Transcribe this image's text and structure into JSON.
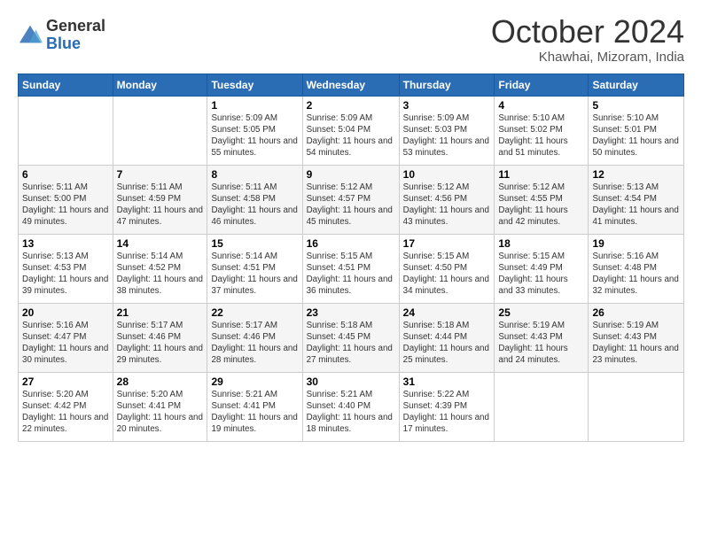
{
  "header": {
    "logo_general": "General",
    "logo_blue": "Blue",
    "month_title": "October 2024",
    "location": "Khawhai, Mizoram, India"
  },
  "weekdays": [
    "Sunday",
    "Monday",
    "Tuesday",
    "Wednesday",
    "Thursday",
    "Friday",
    "Saturday"
  ],
  "weeks": [
    [
      {
        "day": "",
        "sunrise": "",
        "sunset": "",
        "daylight": ""
      },
      {
        "day": "",
        "sunrise": "",
        "sunset": "",
        "daylight": ""
      },
      {
        "day": "1",
        "sunrise": "Sunrise: 5:09 AM",
        "sunset": "Sunset: 5:05 PM",
        "daylight": "Daylight: 11 hours and 55 minutes."
      },
      {
        "day": "2",
        "sunrise": "Sunrise: 5:09 AM",
        "sunset": "Sunset: 5:04 PM",
        "daylight": "Daylight: 11 hours and 54 minutes."
      },
      {
        "day": "3",
        "sunrise": "Sunrise: 5:09 AM",
        "sunset": "Sunset: 5:03 PM",
        "daylight": "Daylight: 11 hours and 53 minutes."
      },
      {
        "day": "4",
        "sunrise": "Sunrise: 5:10 AM",
        "sunset": "Sunset: 5:02 PM",
        "daylight": "Daylight: 11 hours and 51 minutes."
      },
      {
        "day": "5",
        "sunrise": "Sunrise: 5:10 AM",
        "sunset": "Sunset: 5:01 PM",
        "daylight": "Daylight: 11 hours and 50 minutes."
      }
    ],
    [
      {
        "day": "6",
        "sunrise": "Sunrise: 5:11 AM",
        "sunset": "Sunset: 5:00 PM",
        "daylight": "Daylight: 11 hours and 49 minutes."
      },
      {
        "day": "7",
        "sunrise": "Sunrise: 5:11 AM",
        "sunset": "Sunset: 4:59 PM",
        "daylight": "Daylight: 11 hours and 47 minutes."
      },
      {
        "day": "8",
        "sunrise": "Sunrise: 5:11 AM",
        "sunset": "Sunset: 4:58 PM",
        "daylight": "Daylight: 11 hours and 46 minutes."
      },
      {
        "day": "9",
        "sunrise": "Sunrise: 5:12 AM",
        "sunset": "Sunset: 4:57 PM",
        "daylight": "Daylight: 11 hours and 45 minutes."
      },
      {
        "day": "10",
        "sunrise": "Sunrise: 5:12 AM",
        "sunset": "Sunset: 4:56 PM",
        "daylight": "Daylight: 11 hours and 43 minutes."
      },
      {
        "day": "11",
        "sunrise": "Sunrise: 5:12 AM",
        "sunset": "Sunset: 4:55 PM",
        "daylight": "Daylight: 11 hours and 42 minutes."
      },
      {
        "day": "12",
        "sunrise": "Sunrise: 5:13 AM",
        "sunset": "Sunset: 4:54 PM",
        "daylight": "Daylight: 11 hours and 41 minutes."
      }
    ],
    [
      {
        "day": "13",
        "sunrise": "Sunrise: 5:13 AM",
        "sunset": "Sunset: 4:53 PM",
        "daylight": "Daylight: 11 hours and 39 minutes."
      },
      {
        "day": "14",
        "sunrise": "Sunrise: 5:14 AM",
        "sunset": "Sunset: 4:52 PM",
        "daylight": "Daylight: 11 hours and 38 minutes."
      },
      {
        "day": "15",
        "sunrise": "Sunrise: 5:14 AM",
        "sunset": "Sunset: 4:51 PM",
        "daylight": "Daylight: 11 hours and 37 minutes."
      },
      {
        "day": "16",
        "sunrise": "Sunrise: 5:15 AM",
        "sunset": "Sunset: 4:51 PM",
        "daylight": "Daylight: 11 hours and 36 minutes."
      },
      {
        "day": "17",
        "sunrise": "Sunrise: 5:15 AM",
        "sunset": "Sunset: 4:50 PM",
        "daylight": "Daylight: 11 hours and 34 minutes."
      },
      {
        "day": "18",
        "sunrise": "Sunrise: 5:15 AM",
        "sunset": "Sunset: 4:49 PM",
        "daylight": "Daylight: 11 hours and 33 minutes."
      },
      {
        "day": "19",
        "sunrise": "Sunrise: 5:16 AM",
        "sunset": "Sunset: 4:48 PM",
        "daylight": "Daylight: 11 hours and 32 minutes."
      }
    ],
    [
      {
        "day": "20",
        "sunrise": "Sunrise: 5:16 AM",
        "sunset": "Sunset: 4:47 PM",
        "daylight": "Daylight: 11 hours and 30 minutes."
      },
      {
        "day": "21",
        "sunrise": "Sunrise: 5:17 AM",
        "sunset": "Sunset: 4:46 PM",
        "daylight": "Daylight: 11 hours and 29 minutes."
      },
      {
        "day": "22",
        "sunrise": "Sunrise: 5:17 AM",
        "sunset": "Sunset: 4:46 PM",
        "daylight": "Daylight: 11 hours and 28 minutes."
      },
      {
        "day": "23",
        "sunrise": "Sunrise: 5:18 AM",
        "sunset": "Sunset: 4:45 PM",
        "daylight": "Daylight: 11 hours and 27 minutes."
      },
      {
        "day": "24",
        "sunrise": "Sunrise: 5:18 AM",
        "sunset": "Sunset: 4:44 PM",
        "daylight": "Daylight: 11 hours and 25 minutes."
      },
      {
        "day": "25",
        "sunrise": "Sunrise: 5:19 AM",
        "sunset": "Sunset: 4:43 PM",
        "daylight": "Daylight: 11 hours and 24 minutes."
      },
      {
        "day": "26",
        "sunrise": "Sunrise: 5:19 AM",
        "sunset": "Sunset: 4:43 PM",
        "daylight": "Daylight: 11 hours and 23 minutes."
      }
    ],
    [
      {
        "day": "27",
        "sunrise": "Sunrise: 5:20 AM",
        "sunset": "Sunset: 4:42 PM",
        "daylight": "Daylight: 11 hours and 22 minutes."
      },
      {
        "day": "28",
        "sunrise": "Sunrise: 5:20 AM",
        "sunset": "Sunset: 4:41 PM",
        "daylight": "Daylight: 11 hours and 20 minutes."
      },
      {
        "day": "29",
        "sunrise": "Sunrise: 5:21 AM",
        "sunset": "Sunset: 4:41 PM",
        "daylight": "Daylight: 11 hours and 19 minutes."
      },
      {
        "day": "30",
        "sunrise": "Sunrise: 5:21 AM",
        "sunset": "Sunset: 4:40 PM",
        "daylight": "Daylight: 11 hours and 18 minutes."
      },
      {
        "day": "31",
        "sunrise": "Sunrise: 5:22 AM",
        "sunset": "Sunset: 4:39 PM",
        "daylight": "Daylight: 11 hours and 17 minutes."
      },
      {
        "day": "",
        "sunrise": "",
        "sunset": "",
        "daylight": ""
      },
      {
        "day": "",
        "sunrise": "",
        "sunset": "",
        "daylight": ""
      }
    ]
  ]
}
